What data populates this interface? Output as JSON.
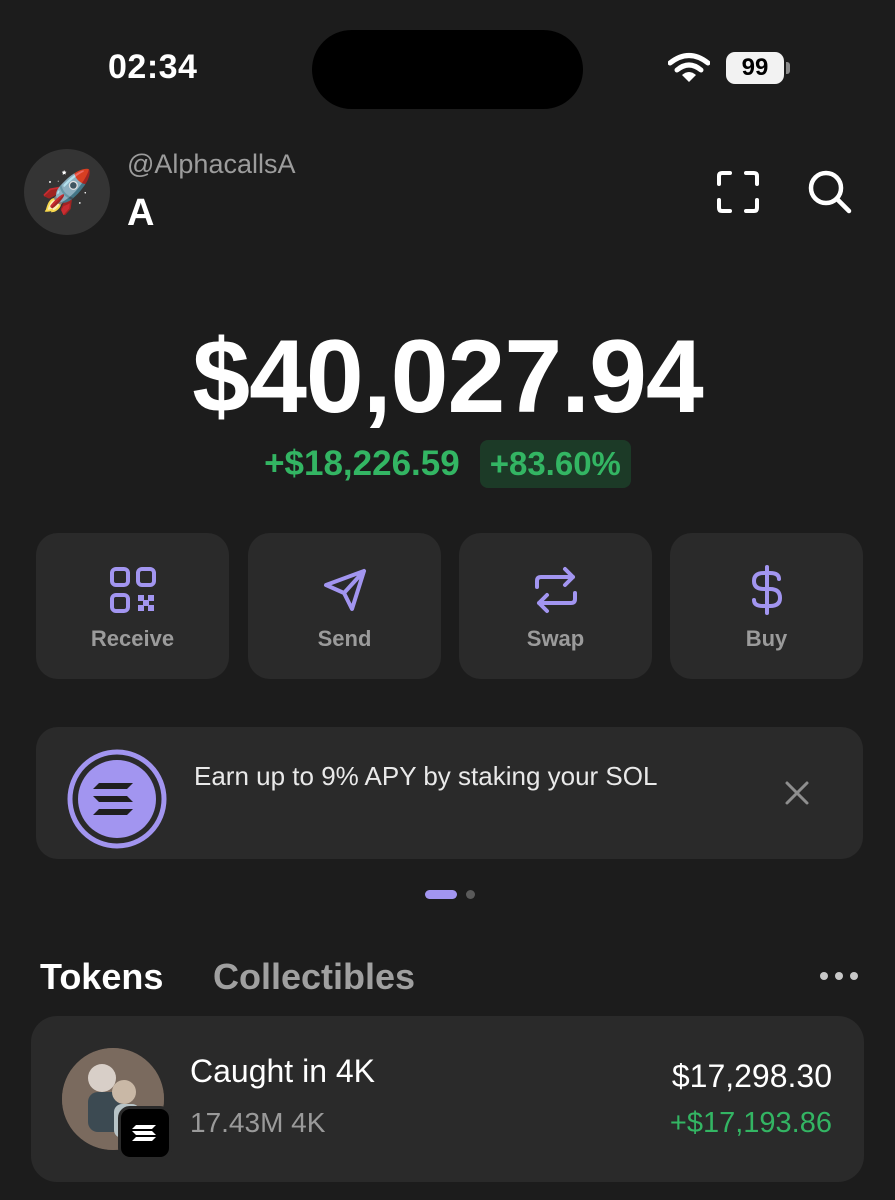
{
  "status_bar": {
    "time": "02:34",
    "battery": "99"
  },
  "header": {
    "avatar_emoji": "🚀",
    "handle": "@AlphacallsA",
    "account_name": "A"
  },
  "balance": {
    "total": "$40,027.94",
    "change_amount": "+$18,226.59",
    "change_percent": "+83.60%"
  },
  "actions": [
    {
      "label": "Receive",
      "icon": "qr-code-icon"
    },
    {
      "label": "Send",
      "icon": "send-icon"
    },
    {
      "label": "Swap",
      "icon": "swap-icon"
    },
    {
      "label": "Buy",
      "icon": "dollar-icon"
    }
  ],
  "promo": {
    "text": "Earn up to 9% APY by staking your SOL"
  },
  "tabs": {
    "tokens": "Tokens",
    "collectibles": "Collectibles"
  },
  "tokens": [
    {
      "name": "Caught in 4K",
      "amount": "17.43M 4K",
      "value": "$17,298.30",
      "change": "+$17,193.86"
    }
  ],
  "colors": {
    "accent": "#a295f0",
    "positive": "#33b563",
    "background": "#1c1c1c",
    "card": "#2a2a2a"
  }
}
